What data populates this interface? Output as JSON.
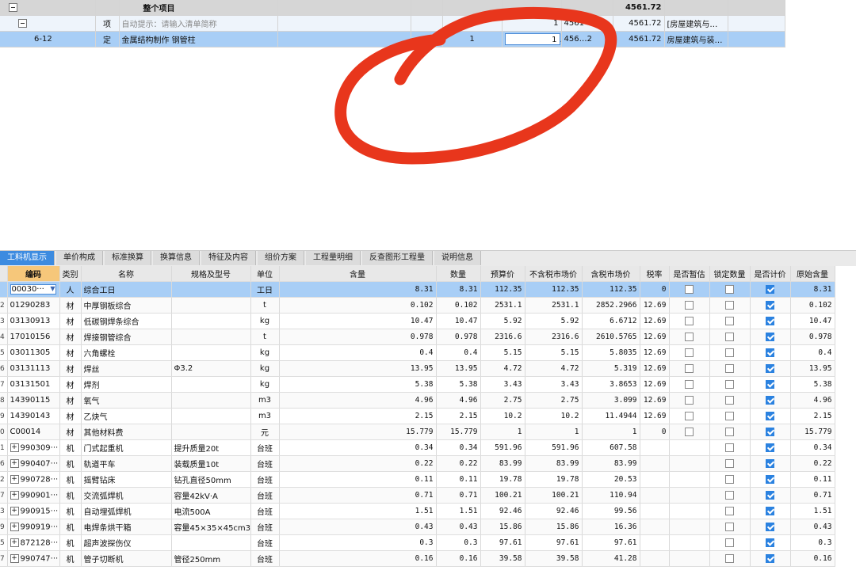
{
  "top_grid": {
    "rows": [
      {
        "code": "",
        "type": "",
        "name": "整个项目",
        "spec": "",
        "qty": "",
        "price": "",
        "total": "4561.72",
        "major": ""
      },
      {
        "code": "",
        "type": "项",
        "name": "自动提示：请输入清单简称",
        "spec": "",
        "qty": "1",
        "price": "4561",
        "total": "4561.72",
        "major": "[房屋建筑与装…"
      },
      {
        "code": "6-12",
        "type": "定",
        "name": "金属结构制作 钢管柱",
        "spec": "",
        "unit_qty": "1",
        "qty": "1",
        "price": "456…2",
        "total": "4561.72",
        "major": "房屋建筑与装…"
      }
    ]
  },
  "tabs": [
    "工料机显示",
    "单价构成",
    "标准换算",
    "换算信息",
    "特征及内容",
    "组价方案",
    "工程量明细",
    "反查图形工程量",
    "说明信息"
  ],
  "columns": [
    "编码",
    "类别",
    "名称",
    "规格及型号",
    "单位",
    "含量",
    "数量",
    "预算价",
    "不含税市场价",
    "含税市场价",
    "税率",
    "是否暂估",
    "锁定数量",
    "是否计价",
    "原始含量"
  ],
  "rows": [
    {
      "rn": "",
      "code": "00030···",
      "cat": "人",
      "name": "综合工日",
      "spec": "",
      "unit": "工日",
      "content": "8.31",
      "qty": "8.31",
      "budget": "112.35",
      "mkt_ex": "112.35",
      "mkt_in": "112.35",
      "tax": "0",
      "est": false,
      "lock": false,
      "priced": true,
      "orig": "8.31",
      "expand": false
    },
    {
      "rn": "2",
      "code": "01290283",
      "cat": "材",
      "name": "中厚钢板综合",
      "spec": "",
      "unit": "t",
      "content": "0.102",
      "qty": "0.102",
      "budget": "2531.1",
      "mkt_ex": "2531.1",
      "mkt_in": "2852.2966",
      "tax": "12.69",
      "est": false,
      "lock": false,
      "priced": true,
      "orig": "0.102",
      "expand": false
    },
    {
      "rn": "3",
      "code": "03130913",
      "cat": "材",
      "name": "低碳钢焊条综合",
      "spec": "",
      "unit": "kg",
      "content": "10.47",
      "qty": "10.47",
      "budget": "5.92",
      "mkt_ex": "5.92",
      "mkt_in": "6.6712",
      "tax": "12.69",
      "est": false,
      "lock": false,
      "priced": true,
      "orig": "10.47",
      "expand": false
    },
    {
      "rn": "4",
      "code": "17010156",
      "cat": "材",
      "name": "焊接钢管综合",
      "spec": "",
      "unit": "t",
      "content": "0.978",
      "qty": "0.978",
      "budget": "2316.6",
      "mkt_ex": "2316.6",
      "mkt_in": "2610.5765",
      "tax": "12.69",
      "est": false,
      "lock": false,
      "priced": true,
      "orig": "0.978",
      "expand": false
    },
    {
      "rn": "5",
      "code": "03011305",
      "cat": "材",
      "name": "六角螺栓",
      "spec": "",
      "unit": "kg",
      "content": "0.4",
      "qty": "0.4",
      "budget": "5.15",
      "mkt_ex": "5.15",
      "mkt_in": "5.8035",
      "tax": "12.69",
      "est": false,
      "lock": false,
      "priced": true,
      "orig": "0.4",
      "expand": false
    },
    {
      "rn": "6",
      "code": "03131113",
      "cat": "材",
      "name": "焊丝",
      "spec": "Φ3.2",
      "unit": "kg",
      "content": "13.95",
      "qty": "13.95",
      "budget": "4.72",
      "mkt_ex": "4.72",
      "mkt_in": "5.319",
      "tax": "12.69",
      "est": false,
      "lock": false,
      "priced": true,
      "orig": "13.95",
      "expand": false
    },
    {
      "rn": "7",
      "code": "03131501",
      "cat": "材",
      "name": "焊剂",
      "spec": "",
      "unit": "kg",
      "content": "5.38",
      "qty": "5.38",
      "budget": "3.43",
      "mkt_ex": "3.43",
      "mkt_in": "3.8653",
      "tax": "12.69",
      "est": false,
      "lock": false,
      "priced": true,
      "orig": "5.38",
      "expand": false
    },
    {
      "rn": "8",
      "code": "14390115",
      "cat": "材",
      "name": "氧气",
      "spec": "",
      "unit": "m3",
      "content": "4.96",
      "qty": "4.96",
      "budget": "2.75",
      "mkt_ex": "2.75",
      "mkt_in": "3.099",
      "tax": "12.69",
      "est": false,
      "lock": false,
      "priced": true,
      "orig": "4.96",
      "expand": false
    },
    {
      "rn": "9",
      "code": "14390143",
      "cat": "材",
      "name": "乙炔气",
      "spec": "",
      "unit": "m3",
      "content": "2.15",
      "qty": "2.15",
      "budget": "10.2",
      "mkt_ex": "10.2",
      "mkt_in": "11.4944",
      "tax": "12.69",
      "est": false,
      "lock": false,
      "priced": true,
      "orig": "2.15",
      "expand": false
    },
    {
      "rn": "0",
      "code": "C00014",
      "cat": "材",
      "name": "其他材料费",
      "spec": "",
      "unit": "元",
      "content": "15.779",
      "qty": "15.779",
      "budget": "1",
      "mkt_ex": "1",
      "mkt_in": "1",
      "tax": "0",
      "est": false,
      "lock": false,
      "priced": true,
      "orig": "15.779",
      "expand": false
    },
    {
      "rn": "1",
      "code": "990309···",
      "cat": "机",
      "name": "门式起重机",
      "spec": "提升质量20t",
      "unit": "台班",
      "content": "0.34",
      "qty": "0.34",
      "budget": "591.96",
      "mkt_ex": "591.96",
      "mkt_in": "607.58",
      "tax": "",
      "est": null,
      "lock": false,
      "priced": true,
      "orig": "0.34",
      "expand": true
    },
    {
      "rn": "6",
      "code": "990407···",
      "cat": "机",
      "name": "轨道平车",
      "spec": "装载质量10t",
      "unit": "台班",
      "content": "0.22",
      "qty": "0.22",
      "budget": "83.99",
      "mkt_ex": "83.99",
      "mkt_in": "83.99",
      "tax": "",
      "est": null,
      "lock": false,
      "priced": true,
      "orig": "0.22",
      "expand": true
    },
    {
      "rn": "2",
      "code": "990728···",
      "cat": "机",
      "name": "摇臂钻床",
      "spec": "钻孔直径50mm",
      "unit": "台班",
      "content": "0.11",
      "qty": "0.11",
      "budget": "19.78",
      "mkt_ex": "19.78",
      "mkt_in": "20.53",
      "tax": "",
      "est": null,
      "lock": false,
      "priced": true,
      "orig": "0.11",
      "expand": true
    },
    {
      "rn": "7",
      "code": "990901···",
      "cat": "机",
      "name": "交流弧焊机",
      "spec": "容量42kV·A",
      "unit": "台班",
      "content": "0.71",
      "qty": "0.71",
      "budget": "100.21",
      "mkt_ex": "100.21",
      "mkt_in": "110.94",
      "tax": "",
      "est": null,
      "lock": false,
      "priced": true,
      "orig": "0.71",
      "expand": true
    },
    {
      "rn": "3",
      "code": "990915···",
      "cat": "机",
      "name": "自动埋弧焊机",
      "spec": "电流500A",
      "unit": "台班",
      "content": "1.51",
      "qty": "1.51",
      "budget": "92.46",
      "mkt_ex": "92.46",
      "mkt_in": "99.56",
      "tax": "",
      "est": null,
      "lock": false,
      "priced": true,
      "orig": "1.51",
      "expand": true
    },
    {
      "rn": "9",
      "code": "990919···",
      "cat": "机",
      "name": "电焊条烘干箱",
      "spec": "容量45×35×45cm3",
      "unit": "台班",
      "content": "0.43",
      "qty": "0.43",
      "budget": "15.86",
      "mkt_ex": "15.86",
      "mkt_in": "16.36",
      "tax": "",
      "est": null,
      "lock": false,
      "priced": true,
      "orig": "0.43",
      "expand": true
    },
    {
      "rn": "5",
      "code": "872128···",
      "cat": "机",
      "name": "超声波探伤仪",
      "spec": "",
      "unit": "台班",
      "content": "0.3",
      "qty": "0.3",
      "budget": "97.61",
      "mkt_ex": "97.61",
      "mkt_in": "97.61",
      "tax": "",
      "est": null,
      "lock": false,
      "priced": true,
      "orig": "0.3",
      "expand": true
    },
    {
      "rn": "7",
      "code": "990747···",
      "cat": "机",
      "name": "管子切断机",
      "spec": "管径250mm",
      "unit": "台班",
      "content": "0.16",
      "qty": "0.16",
      "budget": "39.58",
      "mkt_ex": "39.58",
      "mkt_in": "41.28",
      "tax": "",
      "est": null,
      "lock": false,
      "priced": true,
      "orig": "0.16",
      "expand": true
    }
  ],
  "colors": {
    "tab_active": "#3c8be0",
    "selected_row": "#a8cef6",
    "header_highlight": "#f6c77a",
    "scribble": "#e8361c"
  }
}
